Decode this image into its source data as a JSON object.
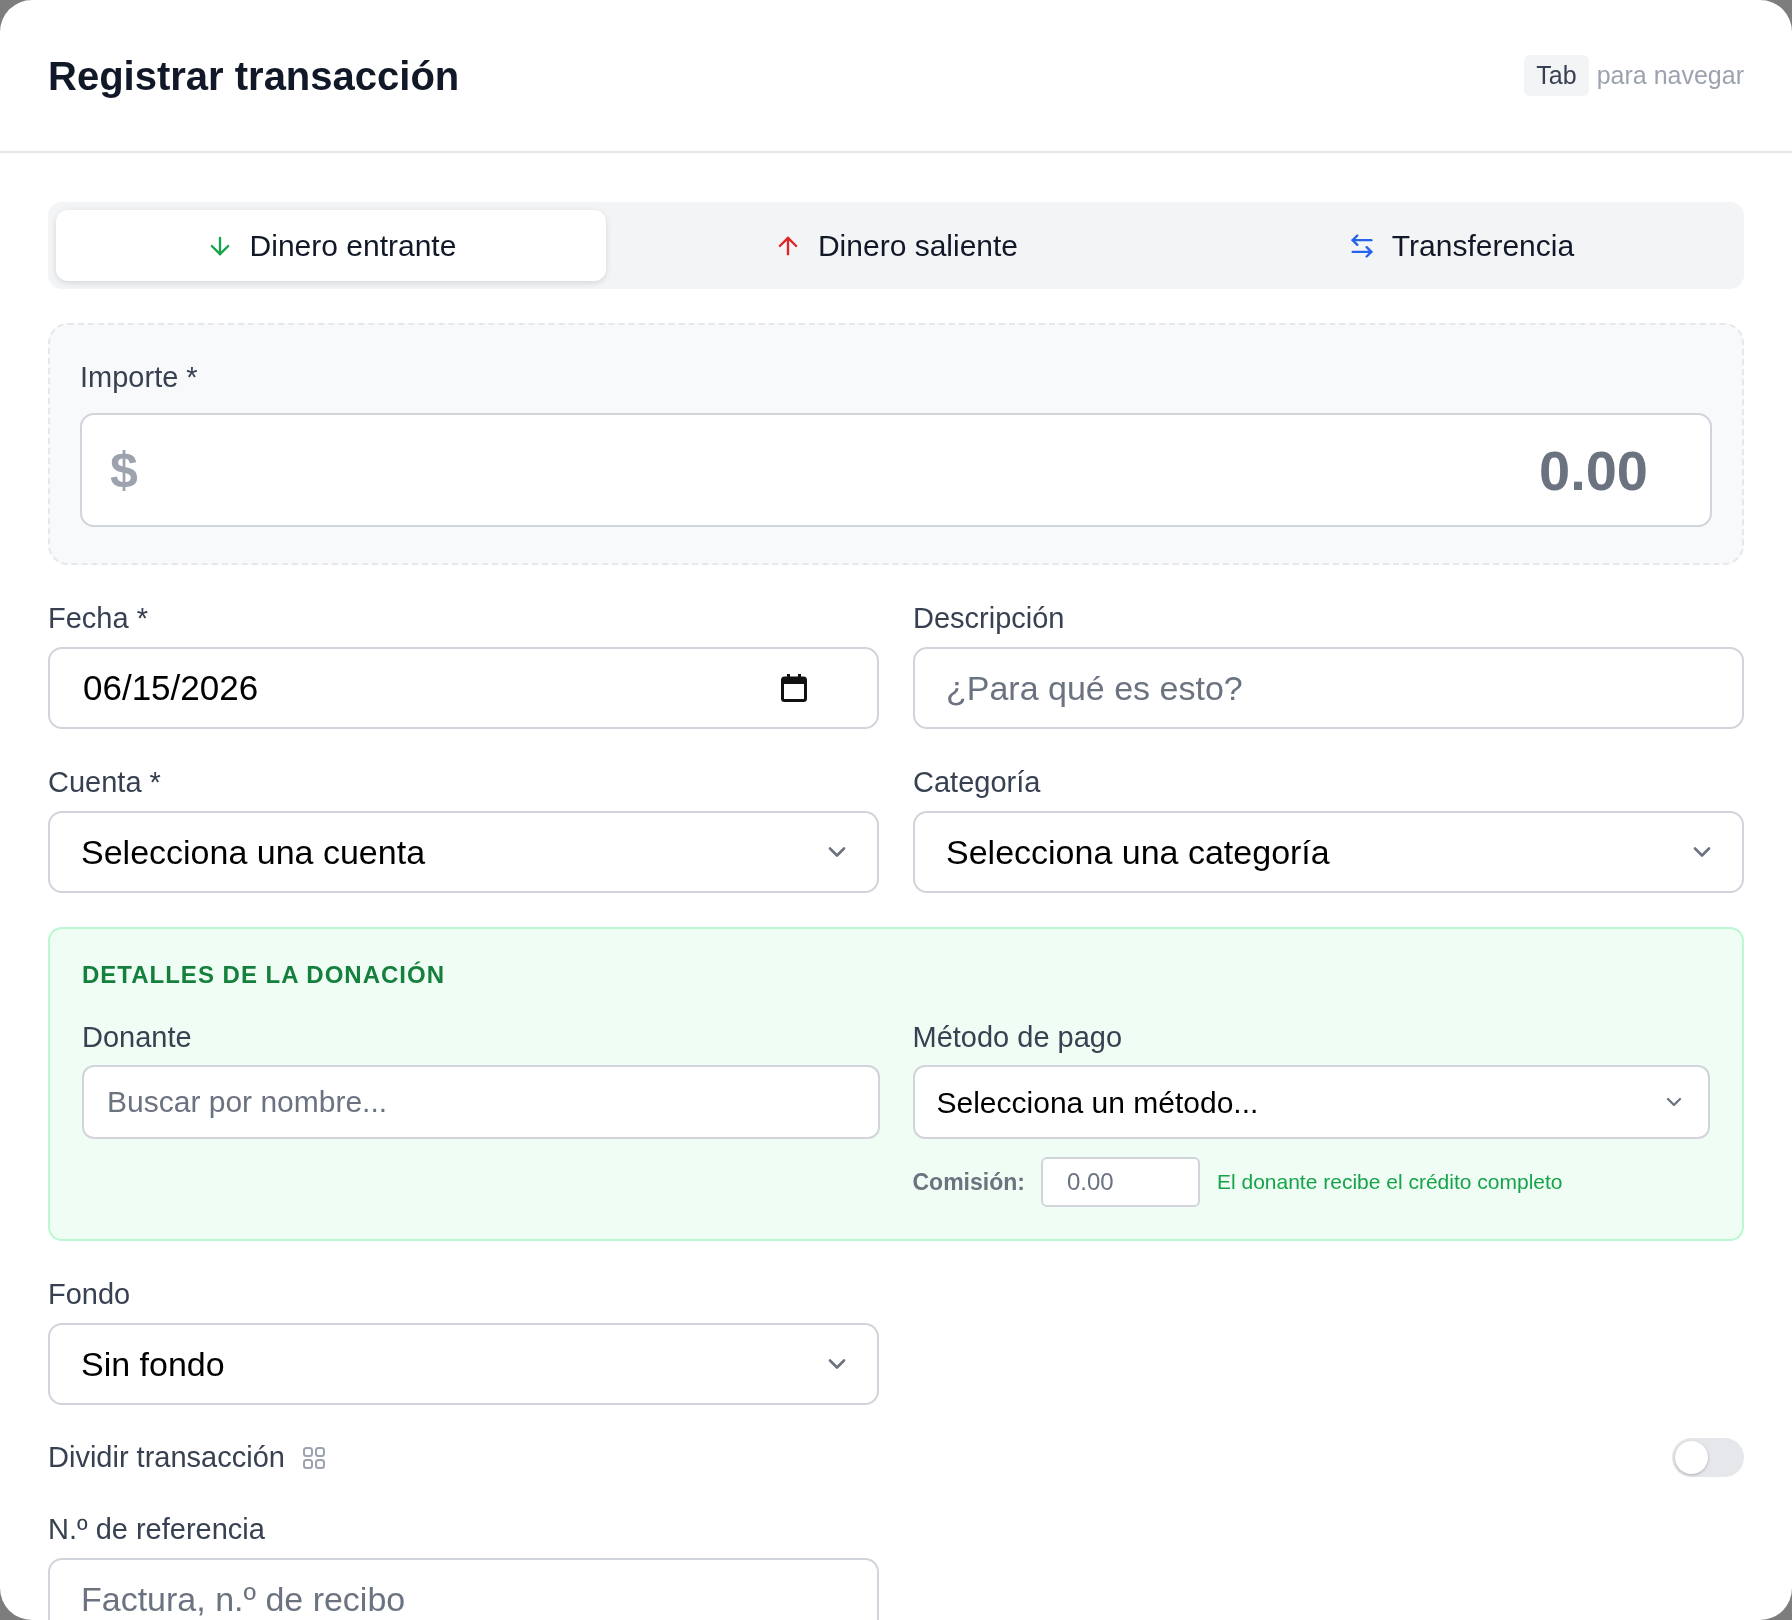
{
  "header": {
    "title": "Registrar transacción",
    "hint_key": "Tab",
    "hint_text": "para navegar"
  },
  "type_tabs": [
    {
      "label": "Dinero entrante",
      "selected": true,
      "kind": "in"
    },
    {
      "label": "Dinero saliente",
      "selected": false,
      "kind": "out"
    },
    {
      "label": "Transferencia",
      "selected": false,
      "kind": "transfer"
    }
  ],
  "amount": {
    "label": "Importe *",
    "currency": "$",
    "placeholder": "0.00"
  },
  "date": {
    "label": "Fecha *",
    "value": "06/15/2026"
  },
  "description": {
    "label": "Descripción",
    "placeholder": "¿Para qué es esto?"
  },
  "account": {
    "label": "Cuenta *",
    "value": "Selecciona una cuenta"
  },
  "category": {
    "label": "Categoría",
    "value": "Selecciona una categoría"
  },
  "donation": {
    "title": "DETALLES DE LA DONACIÓN",
    "donor": {
      "label": "Donante",
      "placeholder": "Buscar por nombre..."
    },
    "payment_method": {
      "label": "Método de pago",
      "value": "Selecciona un método..."
    },
    "fee": {
      "label": "Comisión:",
      "placeholder": "0.00",
      "note": "El donante recibe el crédito completo"
    }
  },
  "fund": {
    "label": "Fondo",
    "value": "Sin fondo"
  },
  "split": {
    "label": "Dividir transacción",
    "on": false
  },
  "reference": {
    "label": "N.º de referencia",
    "placeholder": "Factura, n.º de recibo"
  }
}
